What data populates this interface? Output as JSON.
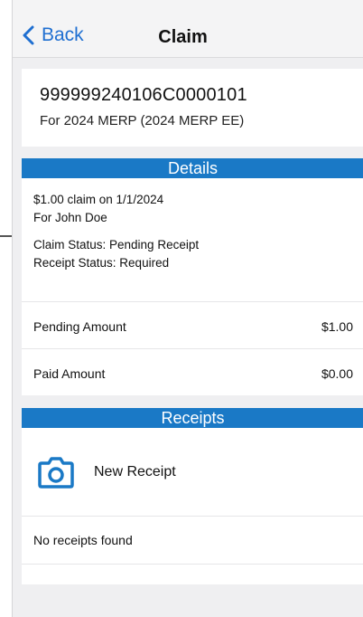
{
  "nav": {
    "back_label": "Back",
    "title": "Claim"
  },
  "claim": {
    "id": "999999240106C0000101",
    "plan": "For 2024 MERP (2024 MERP EE)"
  },
  "details": {
    "header": "Details",
    "summary": "$1.00 claim on 1/1/2024",
    "for": "For John Doe",
    "claim_status": "Claim Status: Pending Receipt",
    "receipt_status": "Receipt Status: Required",
    "rows": [
      {
        "label": "Pending Amount",
        "value": "$1.00"
      },
      {
        "label": "Paid Amount",
        "value": "$0.00"
      }
    ]
  },
  "receipts": {
    "header": "Receipts",
    "new_label": "New Receipt",
    "empty_text": "No receipts found"
  },
  "colors": {
    "accent": "#1a79c6",
    "link": "#1f6fd1",
    "background": "#efeff1"
  },
  "icons": {
    "back": "chevron-left-icon",
    "camera": "camera-icon"
  }
}
